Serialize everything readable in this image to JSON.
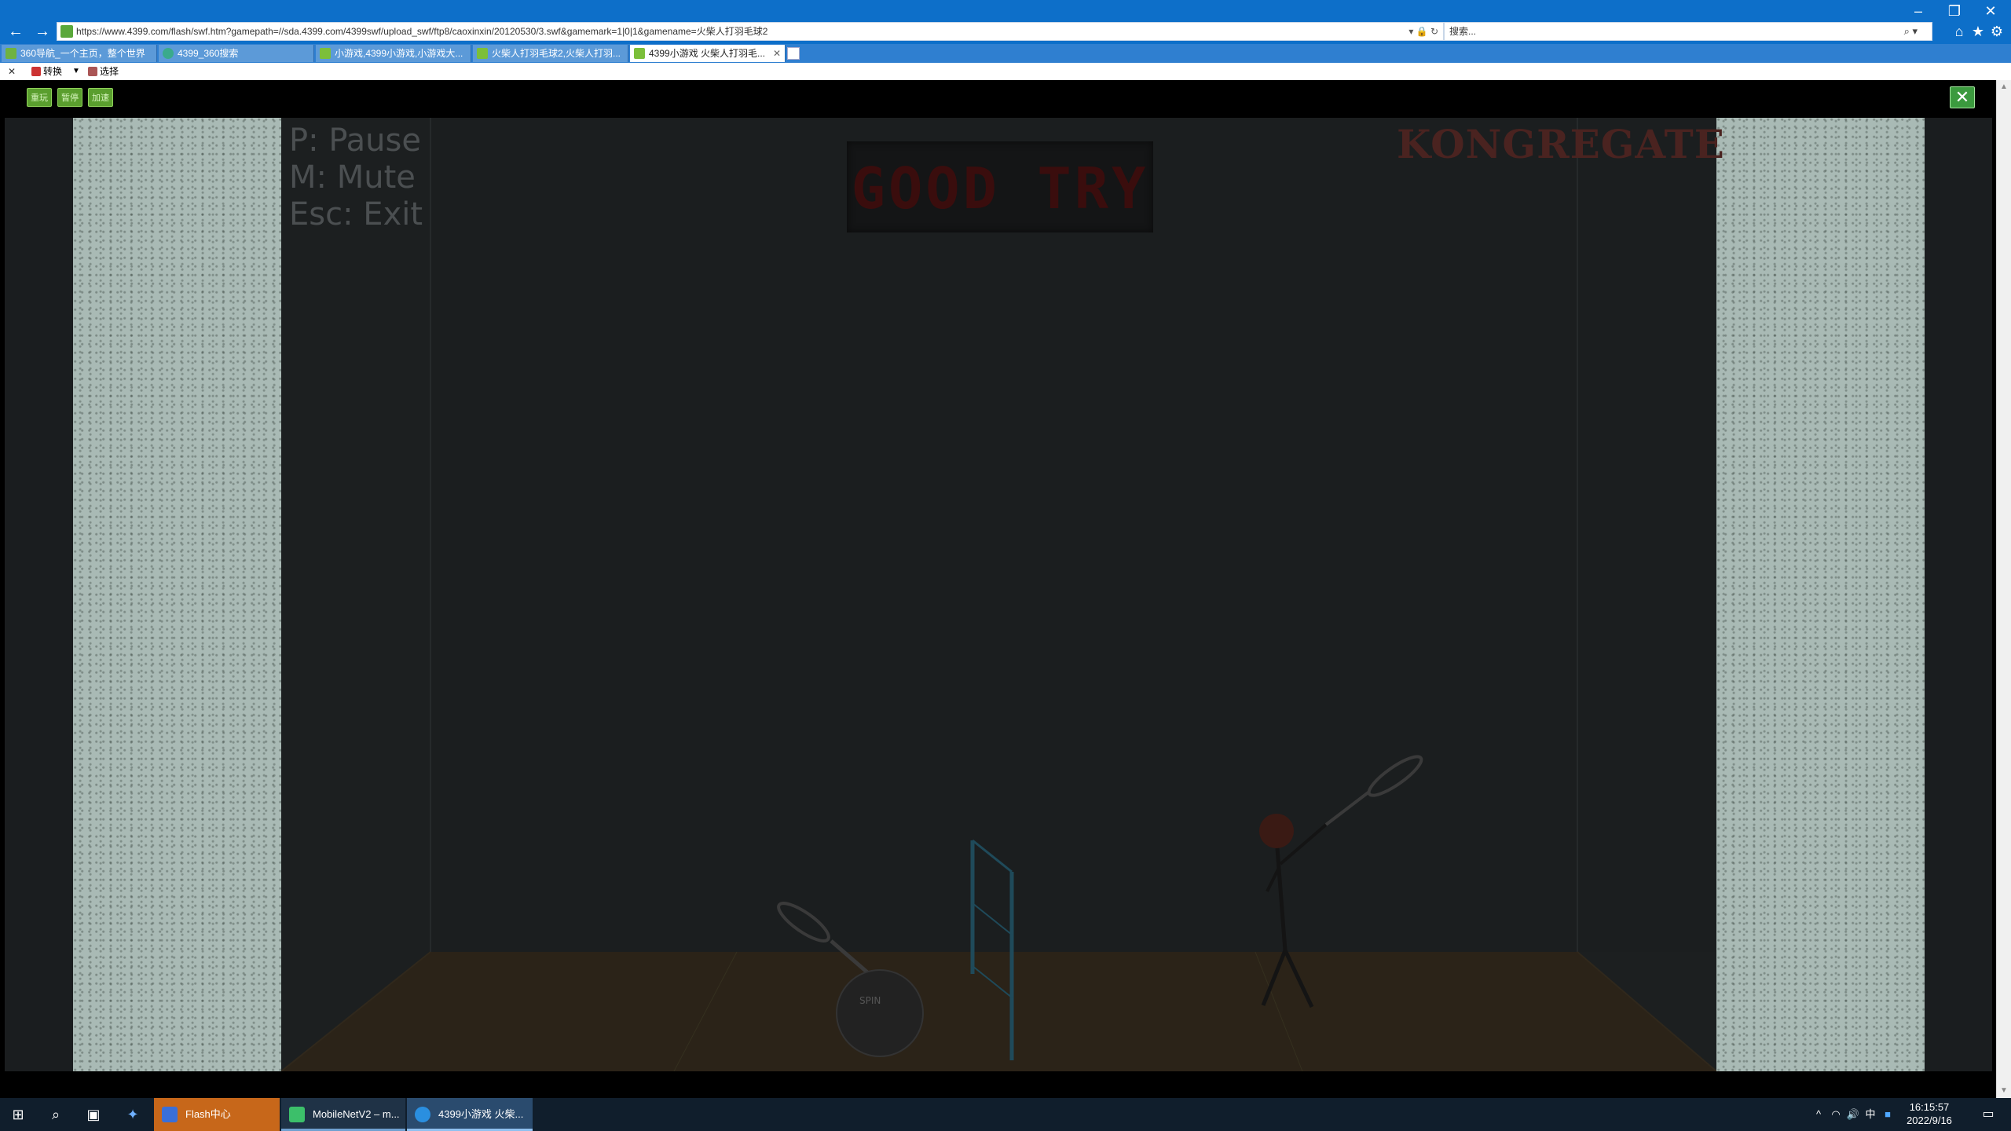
{
  "browser": {
    "address": "https://www.4399.com/flash/swf.htm?gamepath=//sda.4399.com/4399swf/upload_swf/ftp8/caoxinxin/20120530/3.swf&gamemark=1|0|1&gamename=火柴人打羽毛球2",
    "search_placeholder": "搜索...",
    "tabs": [
      {
        "label": "360导航_一个主页，整个世界"
      },
      {
        "label": "4399_360搜索"
      },
      {
        "label": "小游戏,4399小游戏,小游戏大..."
      },
      {
        "label": "火柴人打羽毛球2,火柴人打羽..."
      },
      {
        "label": "4399小游戏 火柴人打羽毛..."
      }
    ],
    "commandbar": {
      "convert_label": "转换",
      "select_label": "选择"
    }
  },
  "game": {
    "buttons": [
      {
        "label": "重玩"
      },
      {
        "label": "暂停"
      },
      {
        "label": "加速"
      }
    ],
    "hud": {
      "pause": "P: Pause",
      "mute": "M: Mute",
      "exit": "Esc: Exit"
    },
    "status_text": "GOOD TRY",
    "brand": "KONGREGATE",
    "ball_label": "SPIN"
  },
  "taskbar": {
    "apps": [
      {
        "label": "Flash中心"
      },
      {
        "label": "MobileNetV2 – m..."
      },
      {
        "label": "4399小游戏 火柴..."
      }
    ],
    "tray": {
      "ime": "中",
      "time": "16:15:57",
      "date": "2022/9/16"
    }
  },
  "colors": {
    "titlebar": "#0d6fc9",
    "taskbar": "#101e2c",
    "game_button": "#5a9e2e",
    "good_try_text": "#3a0d0d",
    "kongregate_text": "#4a2320"
  }
}
